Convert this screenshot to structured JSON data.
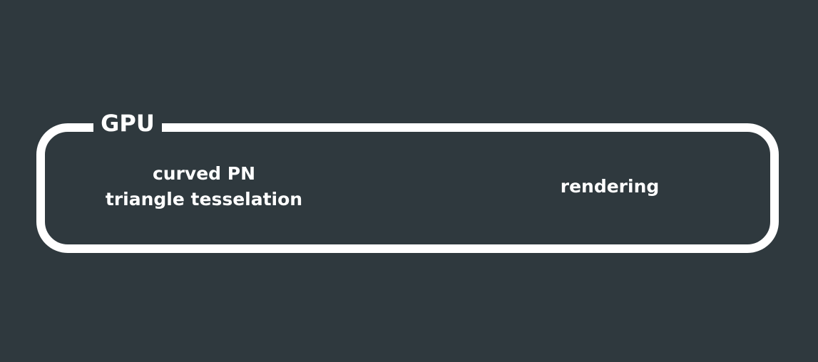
{
  "diagram": {
    "container": {
      "label": "GPU"
    },
    "stages": [
      {
        "lines": [
          "curved PN",
          "triangle tesselation"
        ]
      },
      {
        "lines": [
          "rendering"
        ]
      }
    ]
  },
  "colors": {
    "background": "#2f393e",
    "foreground": "#ffffff"
  }
}
